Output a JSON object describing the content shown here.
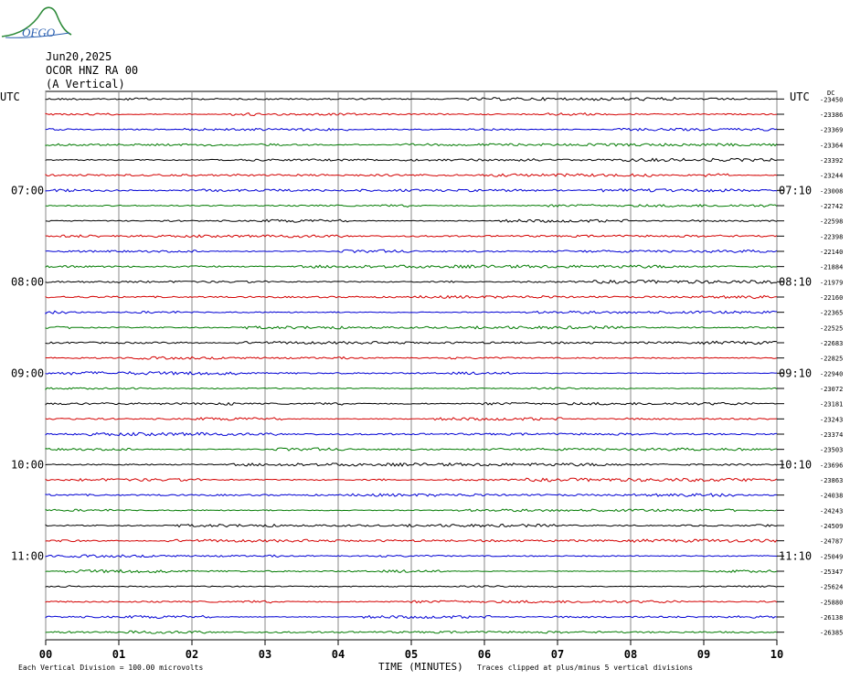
{
  "header": {
    "date": "Jun20,2025",
    "station": "OCOR HNZ RA 00",
    "component": "(A Vertical)",
    "logo_text": "OFGO"
  },
  "chart_data": {
    "type": "line",
    "title": "",
    "left_axis_title": "UTC",
    "right_axis_title": "UTC",
    "right_header": "DC",
    "xlabel": "TIME (MINUTES)",
    "x_ticks": [
      "00",
      "01",
      "02",
      "03",
      "04",
      "05",
      "06",
      "07",
      "08",
      "09",
      "10"
    ],
    "xlim": [
      0,
      10
    ],
    "left_time_labels": [
      {
        "row": 6,
        "text": "07:00"
      },
      {
        "row": 12,
        "text": "08:00"
      },
      {
        "row": 18,
        "text": "09:00"
      },
      {
        "row": 24,
        "text": "10:00"
      },
      {
        "row": 30,
        "text": "11:00"
      }
    ],
    "right_time_labels": [
      {
        "row": 6,
        "text": "07:10"
      },
      {
        "row": 12,
        "text": "08:10"
      },
      {
        "row": 18,
        "text": "09:10"
      },
      {
        "row": 24,
        "text": "10:10"
      },
      {
        "row": 30,
        "text": "11:10"
      }
    ],
    "dc_offsets": [
      "-23450",
      "-23386",
      "-23369",
      "-23364",
      "-23392",
      "-23244",
      "-23008",
      "-22742",
      "-22598",
      "-22398",
      "-22140",
      "-21884",
      "-21979",
      "-22160",
      "-22365",
      "-22525",
      "-22683",
      "-22825",
      "-22940",
      "-23072",
      "-23181",
      "-23243",
      "-23374",
      "-23503",
      "-23696",
      "-23863",
      "-24038",
      "-24243",
      "-24509",
      "-24787",
      "-25049",
      "-25347",
      "-25624",
      "-25880",
      "-26138",
      "-26385"
    ],
    "trace_colors": [
      "#000000",
      "#d40000",
      "#0000d4",
      "#007a00"
    ],
    "grid": true,
    "footer_left": "Each Vertical Division =  100.00 microvolts",
    "footer_right": "Traces clipped at plus/minus 5 vertical divisions"
  }
}
